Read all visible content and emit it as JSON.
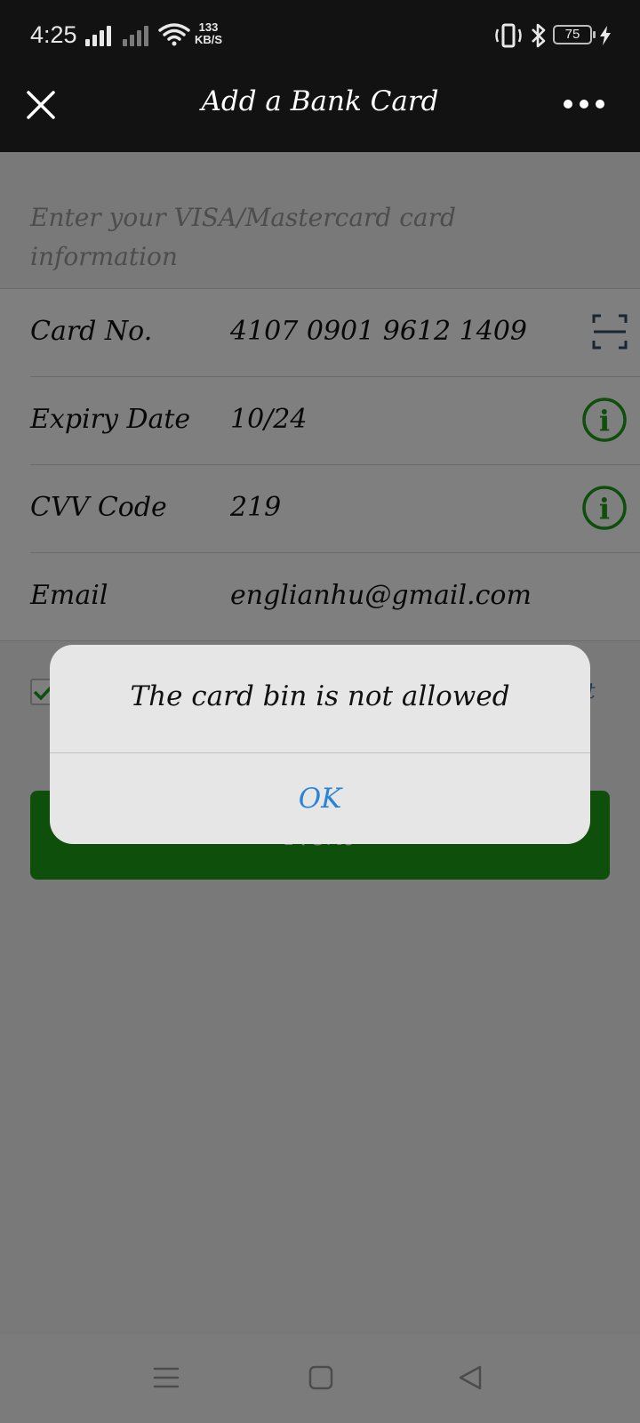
{
  "status_bar": {
    "time": "4:25",
    "net_speed_value": "133",
    "net_speed_unit": "KB/S",
    "battery": "75"
  },
  "header": {
    "title": "Add a Bank Card"
  },
  "intro": "Enter your VISA/Mastercard card information",
  "form": {
    "rows": [
      {
        "label": "Card No.",
        "value": "4107 0901 9612 1409",
        "icon": "scan-icon"
      },
      {
        "label": "Expiry Date",
        "value": "10/24",
        "icon": "info-icon"
      },
      {
        "label": "CVV Code",
        "value": "219",
        "icon": "info-icon"
      },
      {
        "label": "Email",
        "value": "englianhu@gmail.com"
      }
    ]
  },
  "agreement": {
    "checked": true,
    "text_tail": "t"
  },
  "next_button": "Next",
  "dialog": {
    "message": "The card bin is not allowed",
    "ok": "OK"
  },
  "colors": {
    "accent_green": "#1c9e19",
    "dialog_link": "#2a84d6",
    "header_bg": "#121212"
  }
}
